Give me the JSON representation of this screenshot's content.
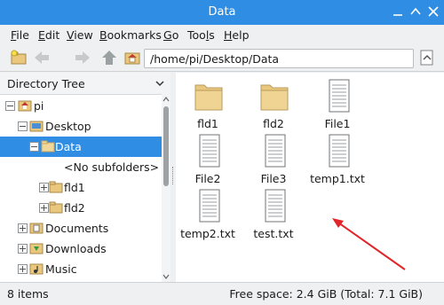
{
  "window": {
    "title": "Data"
  },
  "menu": [
    {
      "underline": "F",
      "rest": "ile"
    },
    {
      "underline": "E",
      "rest": "dit"
    },
    {
      "underline": "V",
      "rest": "iew"
    },
    {
      "underline": "B",
      "rest": "ookmarks"
    },
    {
      "underline": "G",
      "rest": "o"
    },
    {
      "underline": "",
      "rest": "Tools",
      "pre": "Too",
      "u2": "l",
      "post": "s"
    },
    {
      "underline": "H",
      "rest": "elp"
    }
  ],
  "toolbar": {
    "path_value": "/home/pi/Desktop/Data",
    "icons": [
      "new-folder-icon",
      "back-arrow-icon",
      "forward-arrow-icon",
      "up-arrow-icon",
      "home-icon",
      "go-icon"
    ]
  },
  "left_pane": {
    "header": "Directory Tree",
    "tree": [
      {
        "label": "pi",
        "icon": "home-folder-icon",
        "expander": "minus"
      },
      {
        "label": "Desktop",
        "icon": "desktop-icon",
        "expander": "minus"
      },
      {
        "label": "Data",
        "icon": "folder-icon",
        "expander": "minus",
        "selected": true
      },
      {
        "label": "<No subfolders>",
        "icon": "",
        "expander": ""
      },
      {
        "label": "fld1",
        "icon": "folder-icon",
        "expander": "plus"
      },
      {
        "label": "fld2",
        "icon": "folder-icon",
        "expander": "plus"
      },
      {
        "label": "Documents",
        "icon": "documents-folder-icon",
        "expander": "plus"
      },
      {
        "label": "Downloads",
        "icon": "downloads-folder-icon",
        "expander": "plus"
      },
      {
        "label": "Music",
        "icon": "music-folder-icon",
        "expander": "plus"
      }
    ]
  },
  "files": [
    {
      "name": "fld1",
      "type": "folder"
    },
    {
      "name": "fld2",
      "type": "folder"
    },
    {
      "name": "File1",
      "type": "file"
    },
    {
      "name": "File2",
      "type": "file"
    },
    {
      "name": "File3",
      "type": "file"
    },
    {
      "name": "temp1.txt",
      "type": "file"
    },
    {
      "name": "temp2.txt",
      "type": "file"
    },
    {
      "name": "test.txt",
      "type": "file"
    }
  ],
  "status": {
    "items": "8 items",
    "free_space": "Free space: 2.4 GiB (Total: 7.1 GiB)"
  },
  "colors": {
    "accent": "#2f8ee3",
    "annotation_arrow": "#e0262a",
    "folder": "#e9c87e"
  }
}
